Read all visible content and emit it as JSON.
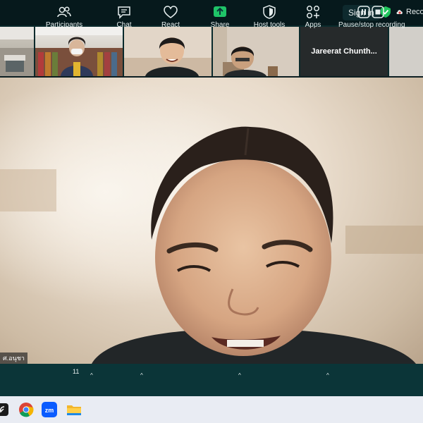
{
  "topbar": {
    "signin_label": "Sign in",
    "record_label": "Recording"
  },
  "thumbnails": [
    {
      "name": ""
    },
    {
      "name": ""
    },
    {
      "name": ""
    },
    {
      "name": ""
    },
    {
      "name": "Jareerat  Chunth..."
    },
    {
      "name": ""
    }
  ],
  "main_video": {
    "speaker_label": "ศ.อนุชา"
  },
  "toolbar": {
    "participants_label": "Participants",
    "participants_count": "11",
    "chat_label": "Chat",
    "react_label": "React",
    "share_label": "Share",
    "host_tools_label": "Host tools",
    "apps_label": "Apps",
    "recording_label": "Pause/stop recording"
  },
  "colors": {
    "toolbar_bg": "#0b3538",
    "share_green": "#1fc468",
    "shield_green": "#22c55e"
  }
}
